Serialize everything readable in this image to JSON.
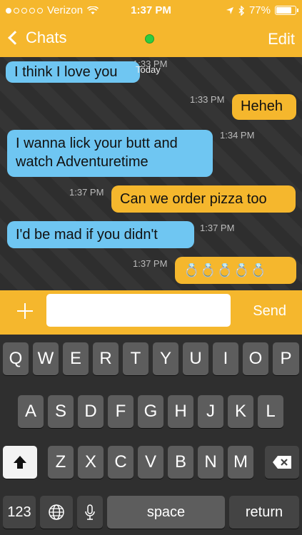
{
  "status": {
    "carrier": "Verizon",
    "time": "1:37 PM",
    "battery": "77%"
  },
  "nav": {
    "back_label": "Chats",
    "edit_label": "Edit"
  },
  "chat": {
    "cutoff_time": "1:33 PM",
    "messages": [
      {
        "dir": "in",
        "text": "I think I love you",
        "time": "Today"
      },
      {
        "dir": "out",
        "text": "Heheh",
        "time": "1:33 PM"
      },
      {
        "dir": "in",
        "text": "I wanna lick your butt and watch Adventuretime",
        "time": "1:34 PM"
      },
      {
        "dir": "out",
        "text": "Can we order pizza too",
        "time": "1:37 PM"
      },
      {
        "dir": "in",
        "text": "I'd be mad if you didn't",
        "time": "1:37 PM"
      },
      {
        "dir": "out",
        "text": "💍💍💍💍💍",
        "time": "1:37 PM"
      }
    ]
  },
  "input": {
    "placeholder": "",
    "value": "",
    "send_label": "Send"
  },
  "keyboard": {
    "row1": [
      "Q",
      "W",
      "E",
      "R",
      "T",
      "Y",
      "U",
      "I",
      "O",
      "P"
    ],
    "row2": [
      "A",
      "S",
      "D",
      "F",
      "G",
      "H",
      "J",
      "K",
      "L"
    ],
    "row3": [
      "Z",
      "X",
      "C",
      "V",
      "B",
      "N",
      "M"
    ],
    "numbers_label": "123",
    "space_label": "space",
    "return_label": "return"
  },
  "icons": [
    "chevron-left-icon",
    "wifi-icon",
    "location-icon",
    "bluetooth-icon",
    "battery-icon",
    "online-dot-icon",
    "plus-icon",
    "shift-icon",
    "backspace-icon",
    "globe-icon",
    "microphone-icon"
  ]
}
